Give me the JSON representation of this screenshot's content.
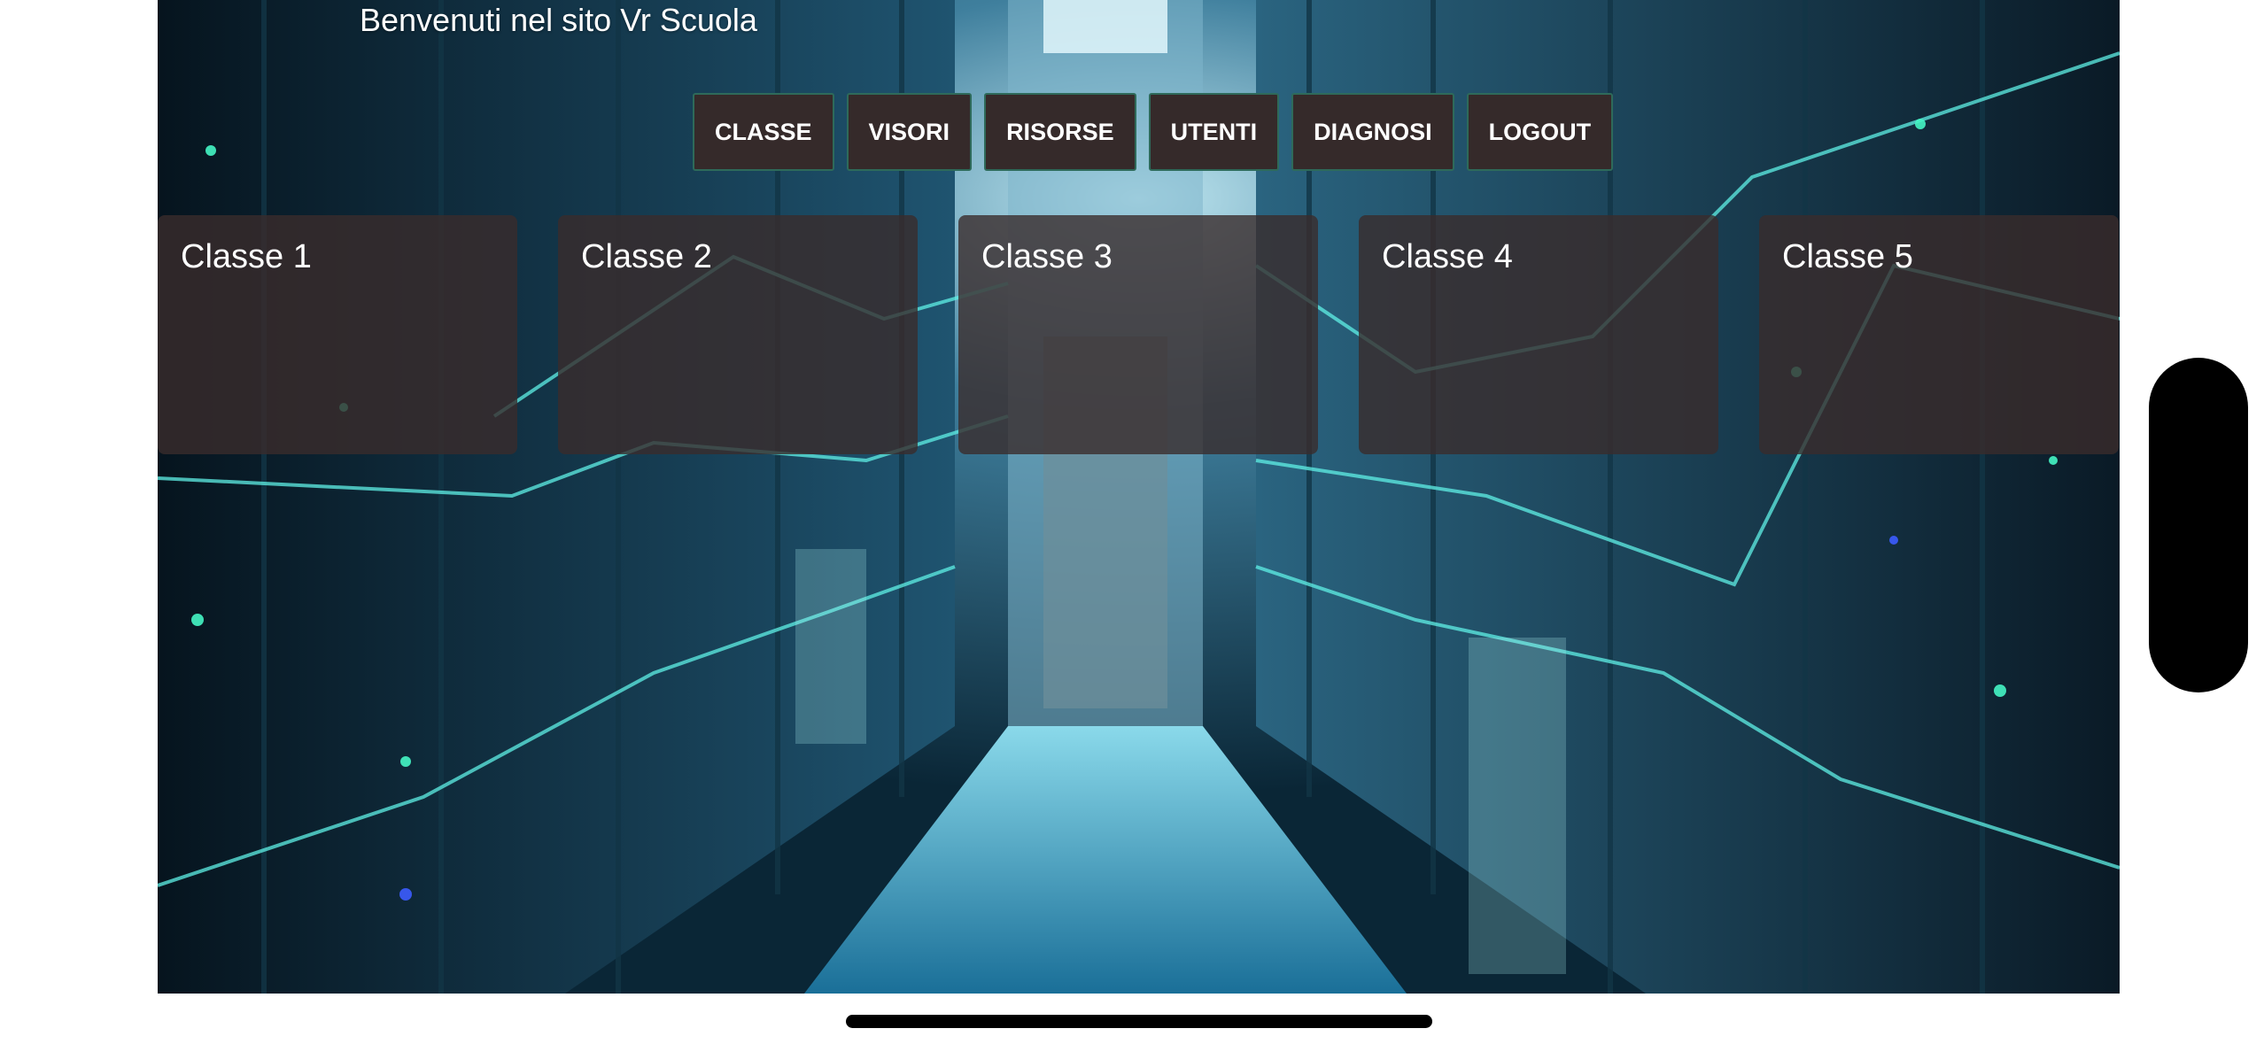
{
  "page": {
    "welcome_title": "Benvenuti nel sito Vr Scuola"
  },
  "nav": {
    "items": [
      {
        "label": "CLASSE"
      },
      {
        "label": "VISORI"
      },
      {
        "label": "RISORSE"
      },
      {
        "label": "UTENTI"
      },
      {
        "label": "DIAGNOSI"
      },
      {
        "label": "LOGOUT"
      }
    ]
  },
  "classes": {
    "items": [
      {
        "name": "Classe 1"
      },
      {
        "name": "Classe 2"
      },
      {
        "name": "Classe 3"
      },
      {
        "name": "Classe 4"
      },
      {
        "name": "Classe 5"
      }
    ]
  },
  "colors": {
    "button_bg": "#352a2a",
    "button_border": "#2e6a5a",
    "card_bg": "rgba(58,44,44,0.80)",
    "scene_accent": "#5ff0e6"
  },
  "background": {
    "icon": "server-room-corridor-image"
  }
}
